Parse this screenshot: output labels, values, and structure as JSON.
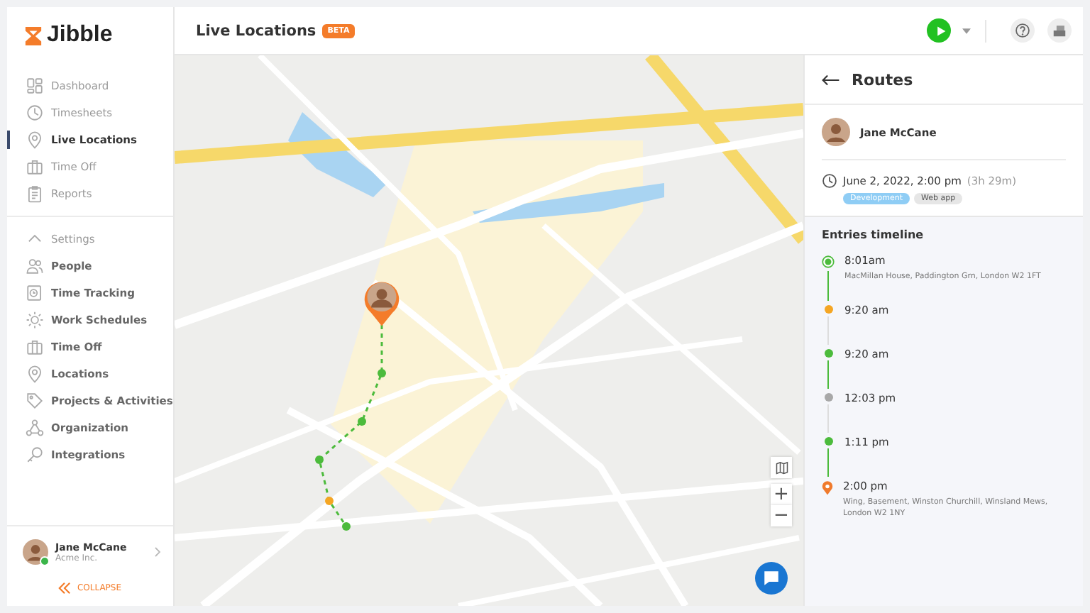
{
  "sidebar": {
    "logo": "Jibble",
    "main_items": [
      {
        "label": "Dashboard",
        "selected": false
      },
      {
        "label": "Timesheets",
        "selected": false
      },
      {
        "label": "Live Locations",
        "selected": true
      },
      {
        "label": "Time Off",
        "selected": false
      },
      {
        "label": "Reports",
        "selected": false
      }
    ],
    "settings": {
      "label": "Settings",
      "expanded": true
    },
    "settings_items": [
      {
        "label": "People"
      },
      {
        "label": "Time Tracking"
      },
      {
        "label": "Work Schedules"
      },
      {
        "label": "Time Off"
      },
      {
        "label": "Locations"
      },
      {
        "label": "Projects & Activities"
      },
      {
        "label": "Organization"
      },
      {
        "label": "Integrations"
      }
    ],
    "user": {
      "name": "Jane McCane",
      "org": "Acme Inc.",
      "online": true
    },
    "collapse": "COLLAPSE"
  },
  "header": {
    "title": "Live Locations",
    "badge": "BETA"
  },
  "map": {
    "controls": [
      "+",
      "−"
    ]
  },
  "routes": {
    "title": "Routes",
    "person": "Jane McCane",
    "date": "June 2, 2022, 2:00 pm",
    "duration": "(3h 29m)",
    "tags": [
      {
        "label": "Development",
        "color": "#8fcdf5"
      },
      {
        "label": "Web app",
        "color": "#e6e6e6"
      }
    ],
    "timeline_title": "Entries timeline",
    "entries": [
      {
        "time": "8:01am",
        "address": "MacMillan House, Paddington Grn, London W2 1FT",
        "color": "#4cbb3c",
        "kind": "start",
        "moving": true
      },
      {
        "time": "9:20 am",
        "color": "#f5a623",
        "kind": "dot",
        "moving": false
      },
      {
        "time": "9:20 am",
        "color": "#4cbb3c",
        "kind": "dot",
        "moving": true
      },
      {
        "time": "12:03 pm",
        "color": "#a8a8a8",
        "kind": "dot",
        "moving": false
      },
      {
        "time": "1:11 pm",
        "color": "#4cbb3c",
        "kind": "dot",
        "moving": true
      },
      {
        "time": "2:00 pm",
        "address": "Wing, Basement, Winston Churchill, Winsland Mews, London W2 1NY",
        "color": "#f07a2c",
        "kind": "pin"
      }
    ]
  }
}
